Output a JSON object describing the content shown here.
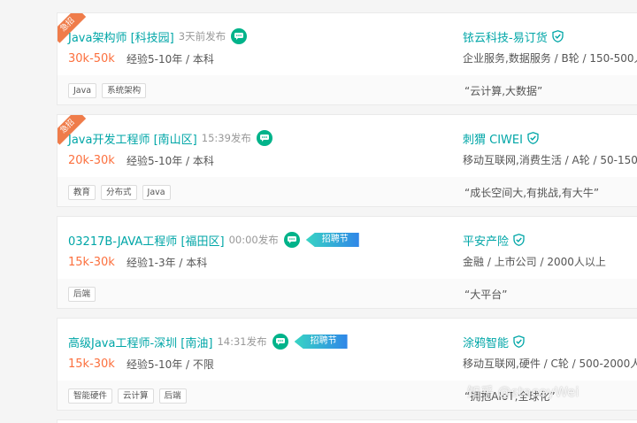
{
  "jobs": [
    {
      "ribbon": "急招",
      "title": "Java架构师 [科技园]",
      "time": "3天前发布",
      "badge": "",
      "salary": "30k-50k",
      "requirement": "经验5-10年 / 本科",
      "company": "铱云科技-易订货",
      "industry": "企业服务,数据服务 / B轮 / 150-500人",
      "tags": [
        "Java",
        "系统架构"
      ],
      "slogan": "“云计算,大数据”"
    },
    {
      "ribbon": "急招",
      "title": "Java开发工程师 [南山区]",
      "time": "15:39发布",
      "badge": "",
      "salary": "20k-30k",
      "requirement": "经验5-10年 / 本科",
      "company": "刺猬 CIWEI",
      "industry": "移动互联网,消费生活 / A轮 / 50-150人",
      "tags": [
        "教育",
        "分布式",
        "Java"
      ],
      "slogan": "“成长空间大,有挑战,有大牛”"
    },
    {
      "ribbon": "",
      "title": "03217B-JAVA工程师 [福田区]",
      "time": "00:00发布",
      "badge": "招聘节",
      "salary": "15k-30k",
      "requirement": "经验1-3年 / 本科",
      "company": "平安产险",
      "industry": "金融 / 上市公司 / 2000人以上",
      "tags": [
        "后端"
      ],
      "slogan": "“大平台”"
    },
    {
      "ribbon": "",
      "title": "高级Java工程师-深圳 [南油]",
      "time": "14:31发布",
      "badge": "招聘节",
      "salary": "15k-30k",
      "requirement": "经验5-10年 / 不限",
      "company": "涂鸦智能",
      "industry": "移动互联网,硬件 / C轮 / 500-2000人",
      "tags": [
        "智能硬件",
        "云计算",
        "后端"
      ],
      "slogan": "“拥抱AIoT,全球化”"
    }
  ],
  "watermark": "知乎 @staceyWei",
  "colors": {
    "accent": "#00a6a7",
    "salary": "#fc703e",
    "ribbon": "#ef7c4a",
    "chat": "#00b38a"
  },
  "icons": {
    "chat": "chat-bubble-icon",
    "verified": "verified-shield-icon"
  }
}
